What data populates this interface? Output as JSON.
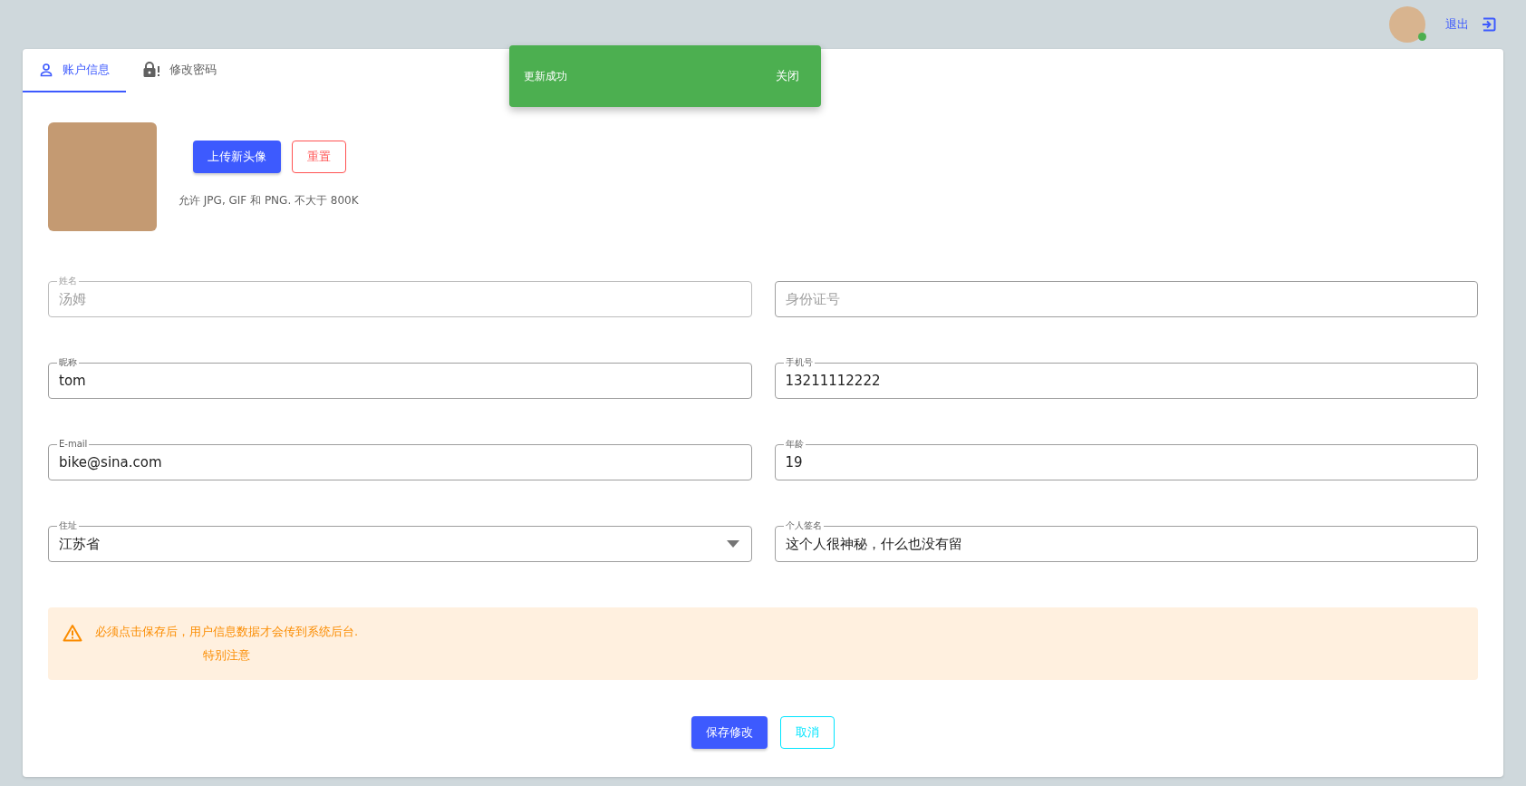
{
  "top_bar": {
    "user_online": true,
    "logout_label": "退出"
  },
  "snackbar": {
    "message": "更新成功",
    "close_label": "关闭"
  },
  "tabs": [
    {
      "label": "账户信息",
      "selected": true
    },
    {
      "label": "修改密码",
      "selected": false
    }
  ],
  "avatar_section": {
    "upload_label": "上传新头像",
    "reset_label": "重置",
    "hint": "允许 JPG, GIF 和 PNG. 不大于 800K"
  },
  "fields": [
    {
      "kind": "text",
      "label": "姓名",
      "value": "汤姆",
      "disabled": true
    },
    {
      "kind": "text",
      "placeholder": "身份证号",
      "disabled": false
    },
    {
      "kind": "text",
      "label": "昵称",
      "value": "tom",
      "disabled": false
    },
    {
      "kind": "text",
      "label": "手机号",
      "value": "13211112222",
      "disabled": false
    },
    {
      "kind": "text",
      "label": "E-mail",
      "value": "bike@sina.com",
      "disabled": false
    },
    {
      "kind": "text",
      "label": "年龄",
      "value": "19",
      "disabled": false
    },
    {
      "kind": "select",
      "label": "住址",
      "value": "江苏省",
      "disabled": false
    },
    {
      "kind": "text",
      "label": "个人签名",
      "value": "这个人很神秘，什么也没有留",
      "disabled": false
    }
  ],
  "alert": {
    "kind": "warning",
    "message": "必须点击保存后，用户信息数据才会传到系统后台.",
    "note": "特别注意"
  },
  "buttons": {
    "save_label": "保存修改",
    "cancel_label": "取消"
  }
}
